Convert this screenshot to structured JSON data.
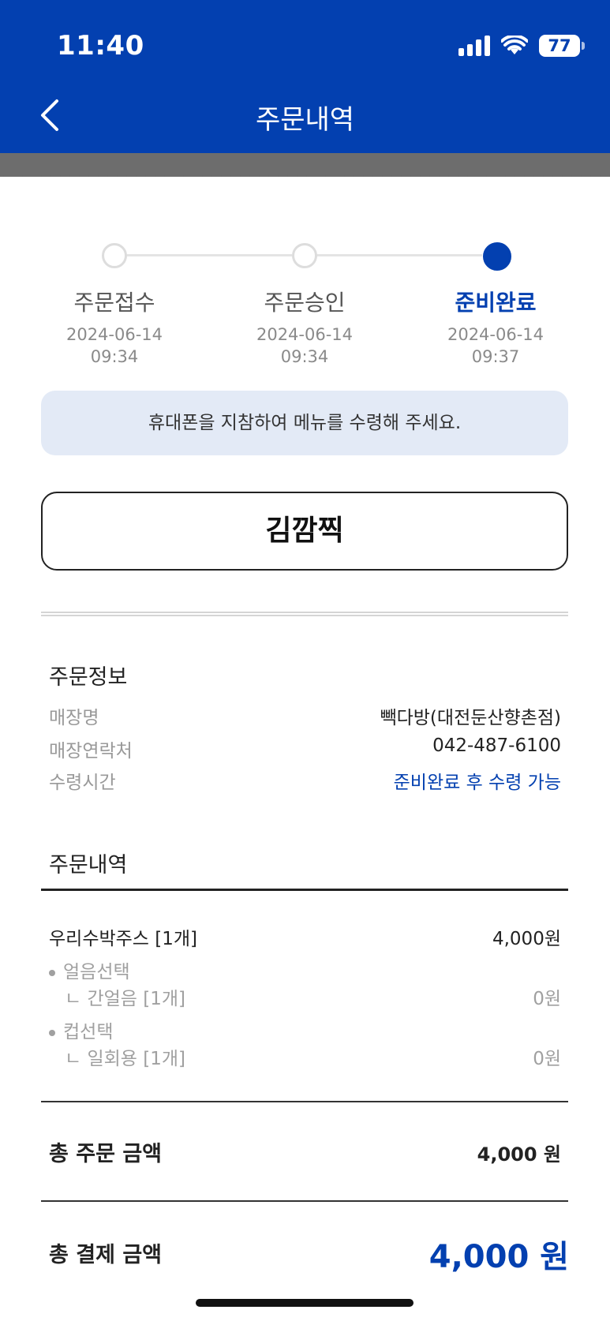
{
  "status_bar": {
    "time": "11:40",
    "battery": "77"
  },
  "header": {
    "title": "주문내역"
  },
  "stepper": [
    {
      "label": "주문접수",
      "date": "2024-06-14",
      "time": "09:34",
      "active": false
    },
    {
      "label": "주문승인",
      "date": "2024-06-14",
      "time": "09:34",
      "active": false
    },
    {
      "label": "준비완료",
      "date": "2024-06-14",
      "time": "09:37",
      "active": true
    }
  ],
  "notice": "휴대폰을 지참하여 메뉴를 수령해 주세요.",
  "customer_name": "김깜찍",
  "order_info": {
    "title": "주문정보",
    "store_label": "매장명",
    "store_value": "빽다방(대전둔산향촌점)",
    "phone_label": "매장연락처",
    "phone_value": "042-487-6100",
    "pickup_label": "수령시간",
    "pickup_value": "준비완료 후 수령 가능"
  },
  "order_details": {
    "title": "주문내역",
    "item_name": "우리수박주스 [1개]",
    "item_price": "4,000원",
    "options": [
      {
        "group": "얼음선택",
        "choice": "ㄴ 간얼음 [1개]",
        "price": "0원"
      },
      {
        "group": "컵선택",
        "choice": "ㄴ 일회용 [1개]",
        "price": "0원"
      }
    ]
  },
  "totals": {
    "order_label": "총 주문 금액",
    "order_value": "4,000 원",
    "payment_label": "총 결제 금액",
    "payment_value": "4,000 원"
  },
  "colors": {
    "brand": "#0340b0",
    "notice_bg": "#e3eaf6"
  }
}
